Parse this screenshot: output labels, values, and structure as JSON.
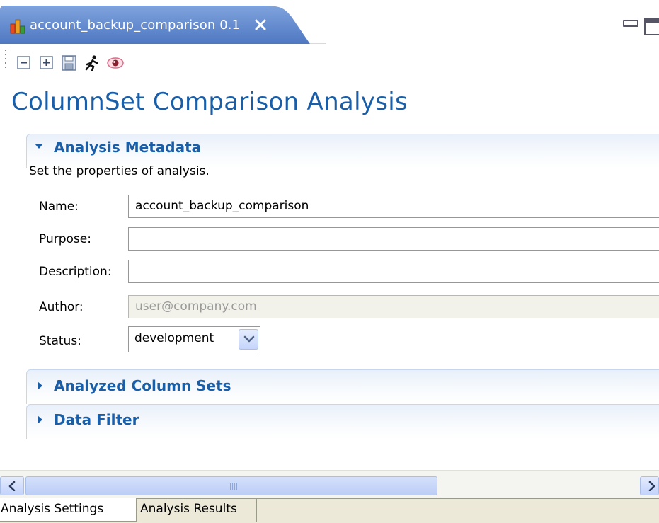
{
  "editor_tab": {
    "title": "account_backup_comparison 0.1",
    "close_glyph": "✕",
    "icon": "bar-chart-icon",
    "active_color": "#5881c9"
  },
  "window_controls": {
    "minimize_icon": "minimize-icon",
    "maximize_icon": "maximize-icon"
  },
  "toolbar": {
    "buttons": [
      {
        "icon": "collapse-all-icon"
      },
      {
        "icon": "expand-all-icon"
      },
      {
        "icon": "save-icon"
      },
      {
        "icon": "run-icon"
      },
      {
        "icon": "eye-icon"
      }
    ]
  },
  "form": {
    "title": "ColumnSet Comparison Analysis",
    "title_color": "#1a5ea8"
  },
  "sections": {
    "metadata": {
      "title": "Analysis Metadata",
      "expanded": true,
      "description": "Set the properties of analysis.",
      "fields": {
        "name": {
          "label": "Name:",
          "value": "account_backup_comparison",
          "placeholder": ""
        },
        "purpose": {
          "label": "Purpose:",
          "value": "",
          "placeholder": ""
        },
        "description": {
          "label": "Description:",
          "value": "",
          "placeholder": ""
        },
        "author": {
          "label": "Author:",
          "value": "user@company.com",
          "disabled": true
        },
        "status": {
          "label": "Status:",
          "selected": "development"
        }
      }
    },
    "column_sets": {
      "title": "Analyzed Column Sets",
      "expanded": false
    },
    "data_filter": {
      "title": "Data Filter",
      "expanded": false
    }
  },
  "scrollbar": {
    "left_icon": "chevron-left-icon",
    "right_icon": "chevron-right-icon"
  },
  "page_tabs": [
    {
      "label": "Analysis Settings",
      "active": true
    },
    {
      "label": "Analysis Results",
      "active": false
    }
  ]
}
